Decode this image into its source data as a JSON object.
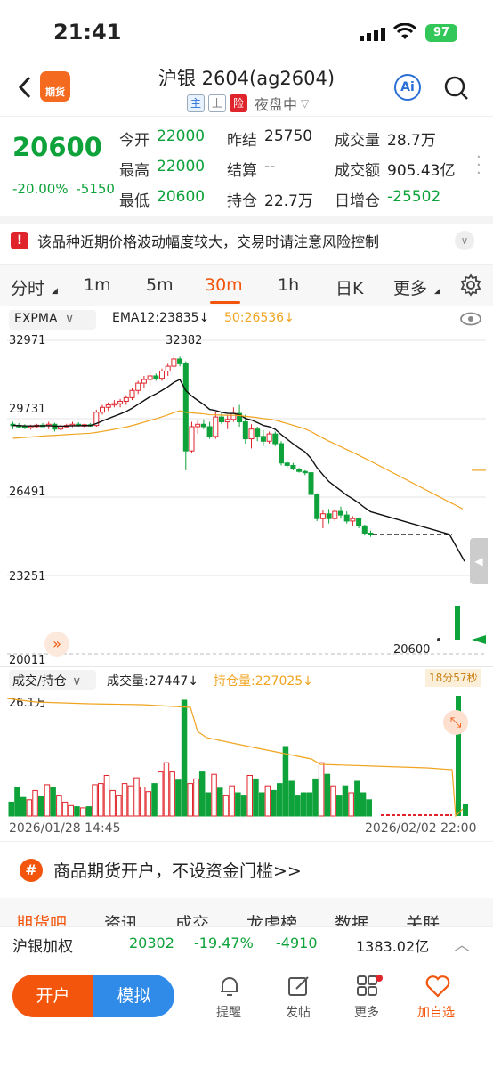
{
  "status": {
    "time": "21:41",
    "battery": "97"
  },
  "header": {
    "title": "沪银 2604(ag2604)",
    "tags": [
      "主",
      "上",
      "险"
    ],
    "session": "夜盘中",
    "ai_label": "Ai"
  },
  "quote": {
    "price": "20600",
    "change_pct": "-20.00%",
    "change": "-5150",
    "fields": [
      {
        "label": "今开",
        "value": "22000"
      },
      {
        "label": "最高",
        "value": "22000"
      },
      {
        "label": "最低",
        "value": "20600"
      },
      {
        "label": "昨结",
        "value": "25750"
      },
      {
        "label": "结算",
        "value": "--"
      },
      {
        "label": "持仓",
        "value": "22.7万"
      },
      {
        "label": "成交量",
        "value": "28.7万"
      },
      {
        "label": "成交额",
        "value": "905.43亿"
      },
      {
        "label": "日增仓",
        "value": "-25502"
      }
    ]
  },
  "notice": {
    "text": "该品种近期价格波动幅度较大，交易时请注意风险控制"
  },
  "tabs": [
    {
      "label": "分时"
    },
    {
      "label": "1m"
    },
    {
      "label": "5m"
    },
    {
      "label": "30m"
    },
    {
      "label": "1h"
    },
    {
      "label": "日K"
    },
    {
      "label": "更多"
    }
  ],
  "active_tab": "30m",
  "main_chart": {
    "indicator": "EXPMA",
    "ema12": "EMA12:23835↓",
    "ema50": "50:26536↓",
    "y_ticks": [
      "32971",
      "29731",
      "26491",
      "23251",
      "20011"
    ],
    "high_label": "32382",
    "last_label": "20600"
  },
  "volume_chart": {
    "indicator": "成交/持仓",
    "volume": "成交量:27447↓",
    "open_interest": "持仓量:227025↓",
    "countdown": "18分57秒",
    "max_label": "26.1万",
    "x_start": "2026/01/28 14:45",
    "x_end": "2026/02/02 22:00"
  },
  "chart_data": {
    "type": "candlestick",
    "ylim": [
      20011,
      32971
    ],
    "candles": [
      [
        29500,
        29600,
        29300,
        29450
      ],
      [
        29450,
        29550,
        29350,
        29400
      ],
      [
        29400,
        29500,
        29300,
        29380
      ],
      [
        29380,
        29480,
        29280,
        29420
      ],
      [
        29420,
        29520,
        29330,
        29460
      ],
      [
        29460,
        29550,
        29380,
        29430
      ],
      [
        29430,
        29600,
        29300,
        29500
      ],
      [
        29500,
        29560,
        29200,
        29300
      ],
      [
        29300,
        29480,
        29250,
        29420
      ],
      [
        29420,
        29520,
        29350,
        29450
      ],
      [
        29450,
        29600,
        29380,
        29500
      ],
      [
        29500,
        29580,
        29400,
        29450
      ],
      [
        29450,
        29520,
        29380,
        29480
      ],
      [
        29480,
        29550,
        29400,
        29450
      ],
      [
        29450,
        30100,
        29400,
        30000
      ],
      [
        30000,
        30300,
        29900,
        30200
      ],
      [
        30200,
        30400,
        30050,
        30300
      ],
      [
        30300,
        30500,
        30200,
        30350
      ],
      [
        30350,
        30550,
        30200,
        30450
      ],
      [
        30450,
        30700,
        30300,
        30600
      ],
      [
        30600,
        31000,
        30500,
        30900
      ],
      [
        30900,
        31300,
        30750,
        31200
      ],
      [
        31200,
        31500,
        31000,
        31350
      ],
      [
        31350,
        31700,
        31100,
        31500
      ],
      [
        31500,
        31600,
        31300,
        31400
      ],
      [
        31400,
        31800,
        31300,
        31700
      ],
      [
        31700,
        32000,
        31500,
        31900
      ],
      [
        31900,
        32382,
        31800,
        32200
      ],
      [
        32200,
        32300,
        31900,
        32000
      ],
      [
        32000,
        32100,
        27600,
        28400
      ],
      [
        28400,
        29600,
        28300,
        29400
      ],
      [
        29400,
        29700,
        29100,
        29500
      ],
      [
        29500,
        29700,
        29300,
        29400
      ],
      [
        29400,
        29600,
        28900,
        29000
      ],
      [
        29000,
        30000,
        28900,
        29800
      ],
      [
        29800,
        30000,
        29500,
        29600
      ],
      [
        29600,
        29900,
        29300,
        29700
      ],
      [
        29700,
        30200,
        29600,
        29950
      ],
      [
        29950,
        30300,
        29400,
        29600
      ],
      [
        29600,
        29900,
        28700,
        28900
      ],
      [
        28900,
        29500,
        28500,
        29300
      ],
      [
        29300,
        29400,
        28800,
        29000
      ],
      [
        29000,
        29250,
        28600,
        28800
      ],
      [
        28800,
        29200,
        28700,
        29100
      ],
      [
        29100,
        29200,
        28600,
        28700
      ],
      [
        28700,
        28800,
        27800,
        27900
      ],
      [
        27900,
        28000,
        27700,
        27800
      ],
      [
        27800,
        27900,
        27600,
        27650
      ],
      [
        27650,
        27700,
        27500,
        27550
      ],
      [
        27550,
        27600,
        27400,
        27500
      ],
      [
        27500,
        27550,
        26400,
        26600
      ],
      [
        26600,
        26650,
        25500,
        25600
      ],
      [
        25600,
        25950,
        25200,
        25800
      ],
      [
        25800,
        26000,
        25400,
        25600
      ],
      [
        25600,
        26000,
        25500,
        25900
      ],
      [
        25900,
        26100,
        25600,
        25750
      ],
      [
        25750,
        25900,
        25400,
        25500
      ],
      [
        25500,
        25700,
        25300,
        25600
      ],
      [
        25600,
        25650,
        25200,
        25300
      ],
      [
        25300,
        25350,
        24900,
        25000
      ],
      [
        25000,
        25100,
        24850,
        24950
      ]
    ],
    "tail_candle": [
      22000,
      22000,
      20600,
      20600
    ]
  },
  "banner": {
    "text": "商品期货开户，不设资金门槛>>"
  },
  "subtabs": [
    "期货吧",
    "资讯",
    "成交",
    "龙虎榜",
    "数据",
    "关联"
  ],
  "ticker": {
    "name": "沪银加权",
    "price": "20302",
    "pct": "-19.47%",
    "change": "-4910",
    "amount": "1383.02亿"
  },
  "bottom_nav": {
    "open_account": "开户",
    "simulate": "模拟",
    "items": [
      "提醒",
      "发帖",
      "更多",
      "加自选"
    ]
  },
  "colors": {
    "up": "#e0242b",
    "down": "#0ea23a",
    "accent": "#f2550b",
    "ema50": "#f0a420"
  }
}
